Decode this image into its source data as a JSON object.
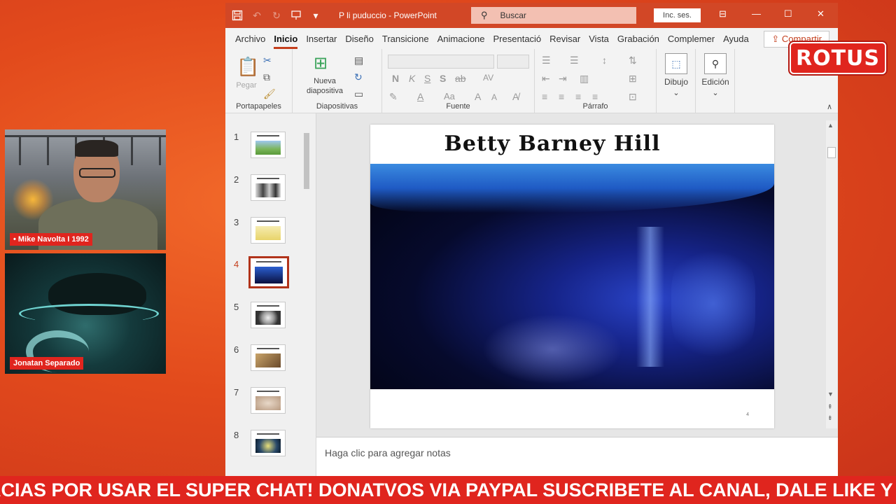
{
  "webcams": [
    {
      "name_label": "• Mike Navolta I 1992"
    },
    {
      "name_label": "Jonatan Separado"
    }
  ],
  "powerpoint": {
    "doc_title": "P li puduccio  -  PowerPoint",
    "search_placeholder": "Buscar",
    "signin_label": "Inc. ses.",
    "tabs": [
      "Archivo",
      "Inicio",
      "Insertar",
      "Diseño",
      "Transicione",
      "Animacione",
      "Presentació",
      "Revisar",
      "Vista",
      "Grabación",
      "Complemer",
      "Ayuda"
    ],
    "share_label": "Compartir",
    "ribbon": {
      "paste_label": "Pegar",
      "new_slide_line1": "Nueva",
      "new_slide_line2": "diapositiva",
      "font_bold": "N",
      "font_italic": "K",
      "font_underline": "S",
      "font_strike": "S",
      "font_spacing": "AV",
      "font_case": "Aa",
      "grow_font": "A",
      "shrink_font": "A",
      "font_color": "A",
      "drawing_label": "Dibujo",
      "editing_label": "Edición",
      "groups": {
        "clipboard": "Portapapeles",
        "slides": "Diapositivas",
        "font": "Fuente",
        "paragraph": "Párrafo"
      }
    },
    "thumbnails": [
      {
        "num": "1",
        "selected": false
      },
      {
        "num": "2",
        "selected": false
      },
      {
        "num": "3",
        "selected": false
      },
      {
        "num": "4",
        "selected": true
      },
      {
        "num": "5",
        "selected": false
      },
      {
        "num": "6",
        "selected": false
      },
      {
        "num": "7",
        "selected": false
      },
      {
        "num": "8",
        "selected": false
      }
    ],
    "slide": {
      "title": "Betty Barney Hill",
      "page_number": "4"
    },
    "notes_placeholder": "Haga clic para agregar notas"
  },
  "badge": "ROTUS",
  "ticker_text": "ACIAS POR USAR EL SUPER CHAT! DONATVOS VIA PAYPAL SUSCRIBETE AL CANAL, DALE LIKE Y C",
  "colors": {
    "ppt_accent": "#d24726",
    "stream_red": "#e0251e"
  }
}
